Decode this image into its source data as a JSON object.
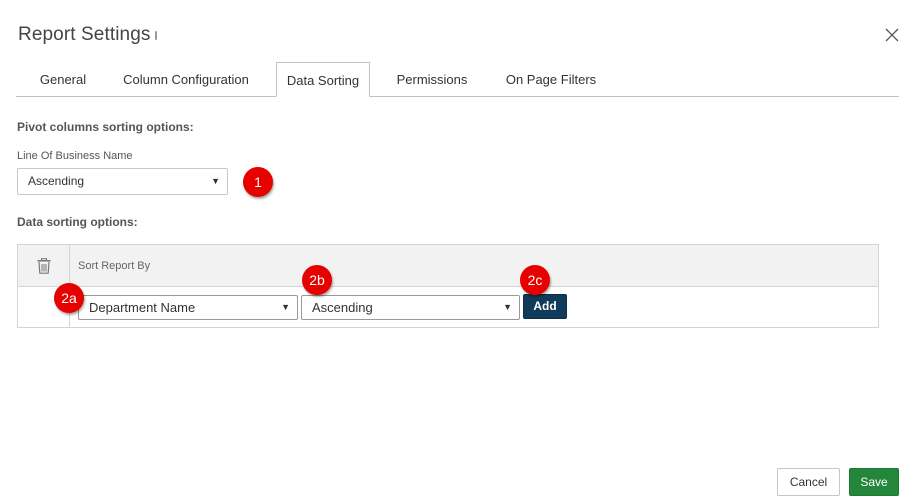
{
  "dialog": {
    "title": "Report Settings",
    "close_icon": "close-icon"
  },
  "tabs": [
    {
      "label": "General",
      "active": false
    },
    {
      "label": "Column Configuration",
      "active": false
    },
    {
      "label": "Data Sorting",
      "active": true
    },
    {
      "label": "Permissions",
      "active": false
    },
    {
      "label": "On Page Filters",
      "active": false
    }
  ],
  "pivot": {
    "section_label": "Pivot columns sorting options:",
    "field_label": "Line Of Business Name",
    "selected": "Ascending",
    "badge": "1"
  },
  "data_sorting": {
    "section_label": "Data sorting options:",
    "column_header": "Sort Report By",
    "delete_icon": "trash-icon",
    "field_select": "Department Name",
    "order_select": "Ascending",
    "add_label": "Add",
    "badges": {
      "field": "2a",
      "order": "2b",
      "add": "2c"
    }
  },
  "footer": {
    "cancel_label": "Cancel",
    "save_label": "Save",
    "save_color": "#23863b"
  },
  "colors": {
    "add_button": "#0f3a5a",
    "badge": "#e60000"
  }
}
